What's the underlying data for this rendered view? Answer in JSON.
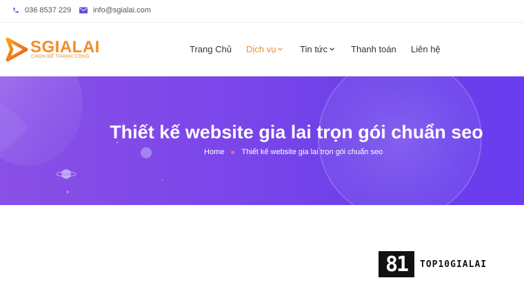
{
  "topbar": {
    "phone": "036 8537 229",
    "email": "info@sgialai.com",
    "phone_icon": "phone-icon",
    "email_icon": "envelope-icon"
  },
  "logo": {
    "name": "SGIALAI",
    "tagline": "CHỌN ĐỂ THÀNH CÔNG"
  },
  "nav": {
    "items": [
      {
        "label": "Trang Chủ",
        "active": false,
        "dropdown": false
      },
      {
        "label": "Dịch vụ",
        "active": true,
        "dropdown": true
      },
      {
        "label": "Tin tức",
        "active": false,
        "dropdown": true
      },
      {
        "label": "Thanh toán",
        "active": false,
        "dropdown": false
      },
      {
        "label": "Liên hệ",
        "active": false,
        "dropdown": false
      }
    ]
  },
  "banner": {
    "title": "Thiết kế website gia lai trọn gói chuẩn seo",
    "breadcrumb": {
      "home": "Home",
      "current": "Thiết kế website gia lai trọn gói chuẩn seo"
    }
  },
  "watermark": {
    "badge": "81",
    "text": "TOP10GIALAI"
  },
  "colors": {
    "accent": "#f28c28",
    "icon": "#5b4fd8",
    "banner_start": "#8a4fe6",
    "banner_end": "#6a3df0",
    "crumb_dot": "#ff6a6a"
  }
}
